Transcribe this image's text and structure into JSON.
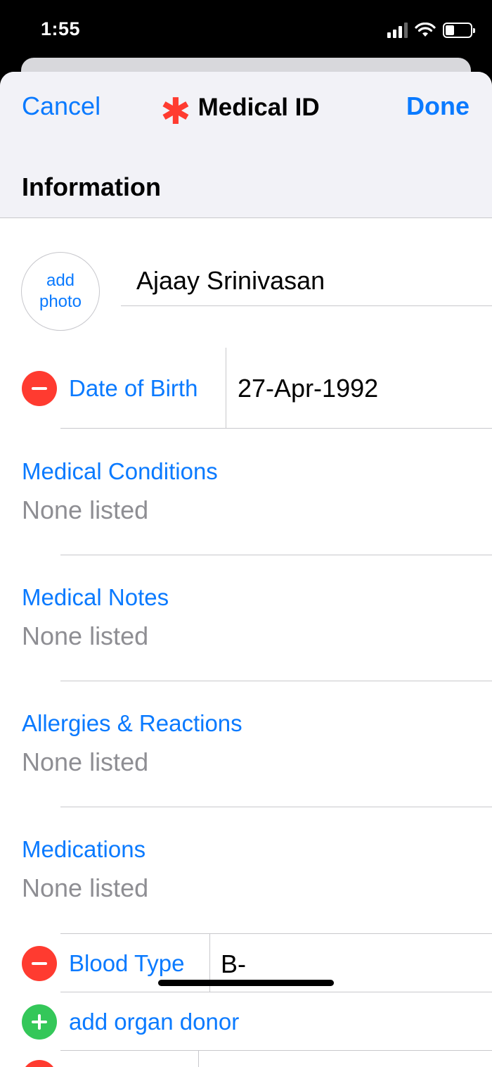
{
  "status": {
    "time": "1:55"
  },
  "nav": {
    "cancel_label": "Cancel",
    "title": "Medical ID",
    "done_label": "Done",
    "title_icon": "medical-asterisk-icon",
    "accent": "#0a7aff",
    "asterisk_color": "#ff3b30"
  },
  "section": {
    "heading": "Information"
  },
  "profile": {
    "photo_line1": "add",
    "photo_line2": "photo",
    "name": "Ajaay Srinivasan"
  },
  "fields": {
    "dob": {
      "label": "Date of Birth",
      "value": "27-Apr-1992"
    },
    "conditions": {
      "label": "Medical Conditions",
      "value": "None listed"
    },
    "notes": {
      "label": "Medical Notes",
      "value": "None listed"
    },
    "allergies": {
      "label": "Allergies & Reactions",
      "value": "None listed"
    },
    "medications": {
      "label": "Medications",
      "value": "None listed"
    },
    "blood": {
      "label": "Blood Type",
      "value": "B-"
    },
    "organ": {
      "label": "add organ donor"
    }
  }
}
